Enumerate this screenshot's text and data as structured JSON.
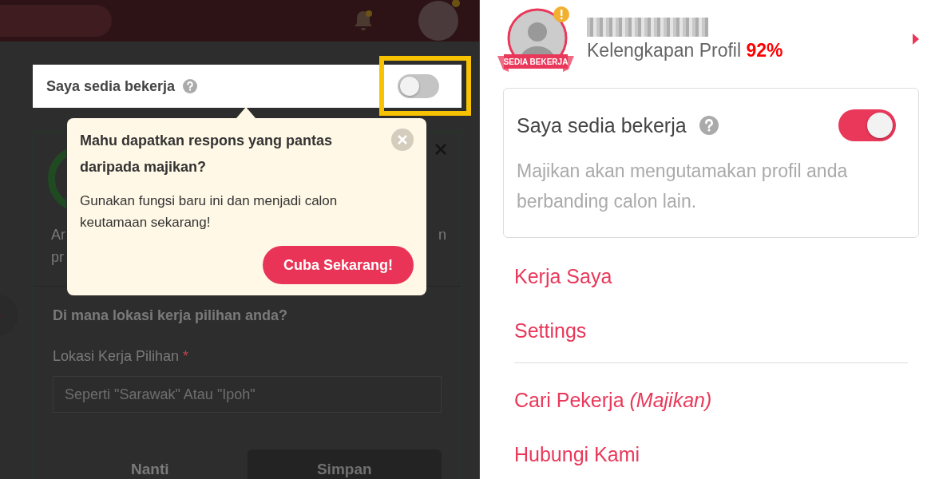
{
  "background_page": {
    "availability": {
      "label": "Saya sedia bekerja",
      "on": false
    },
    "card": {
      "text_left": "Ar",
      "text_right": "n",
      "text_line2": "pr"
    },
    "form": {
      "question": "Di mana lokasi kerja pilihan anda?",
      "field_label": "Lokasi Kerja Pilihan",
      "required_mark": "*",
      "placeholder": "Seperti \"Sarawak\" Atau \"Ipoh\"",
      "buttons": [
        {
          "label": "Nanti",
          "kind": "text"
        },
        {
          "label": "Simpan",
          "kind": "filled"
        }
      ]
    }
  },
  "tooltip": {
    "title": "Mahu dapatkan respons yang pantas daripada majikan?",
    "body": "Gunakan fungsi baru ini dan menjadi calon keutamaan sekarang!",
    "button": "Cuba Sekarang!"
  },
  "side_menu": {
    "badge": "SEDIA BEKERJA",
    "profile_completeness": "Kelengkapan Profil **92%**",
    "availability": {
      "label": "Saya sedia bekerja",
      "on": true,
      "description": "Majikan akan mengutamakan profil anda berbanding calon lain."
    },
    "items": [
      {
        "label": "Kerja Saya",
        "divider_after": false
      },
      {
        "label": "Settings",
        "divider_after": true
      },
      {
        "label": "Cari Pekerja *(Majikan)*",
        "divider_after": false
      },
      {
        "label": "Hubungi Kami",
        "divider_after": false
      }
    ]
  }
}
